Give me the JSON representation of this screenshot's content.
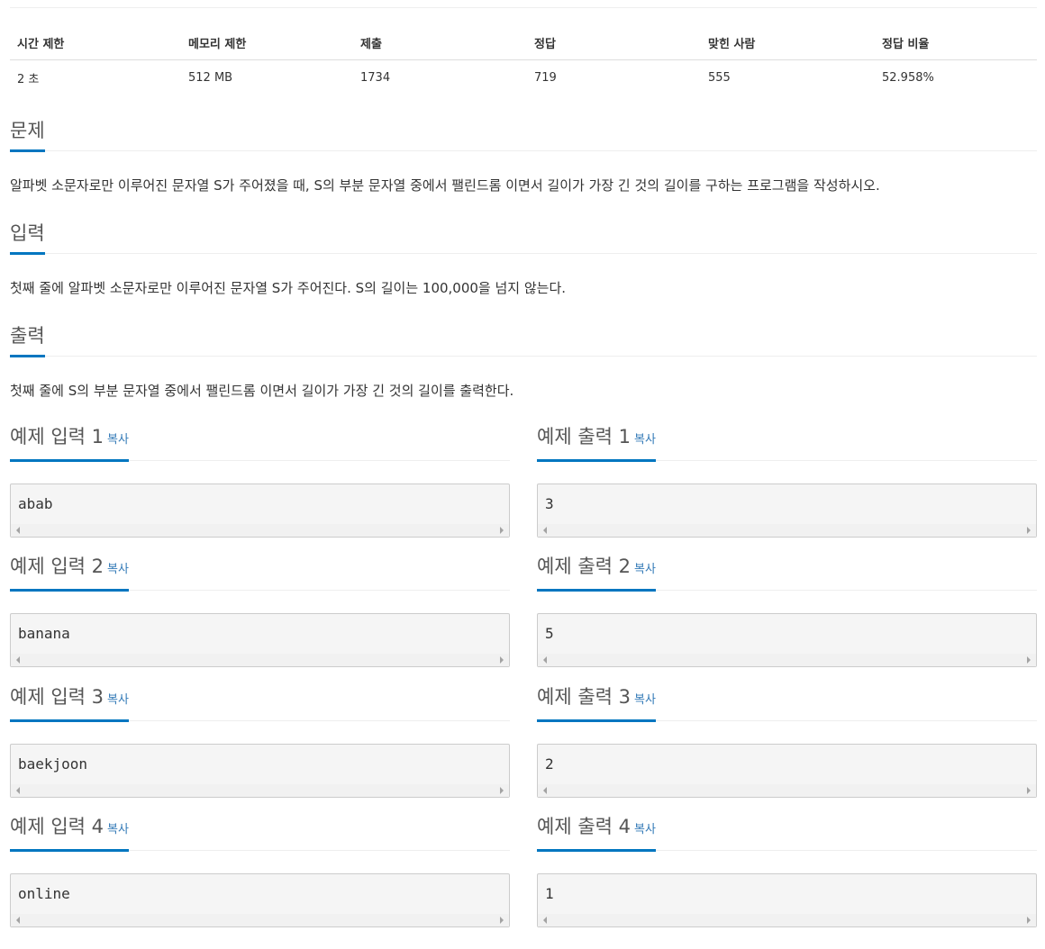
{
  "info": {
    "headers": [
      "시간 제한",
      "메모리 제한",
      "제출",
      "정답",
      "맞힌 사람",
      "정답 비율"
    ],
    "values": [
      "2 초",
      "512 MB",
      "1734",
      "719",
      "555",
      "52.958%"
    ]
  },
  "problem": {
    "title": "문제",
    "text": "알파벳 소문자로만 이루어진 문자열 S가 주어졌을 때, S의 부분 문자열 중에서 팰린드롬 이면서 길이가 가장 긴 것의 길이를 구하는 프로그램을 작성하시오."
  },
  "input": {
    "title": "입력",
    "text": "첫째 줄에 알파벳 소문자로만 이루어진 문자열 S가 주어진다. S의 길이는 100,000을 넘지 않는다."
  },
  "output": {
    "title": "출력",
    "text": "첫째 줄에 S의 부분 문자열 중에서 팰린드롬 이면서 길이가 가장 긴 것의 길이를 출력한다."
  },
  "copy_label": "복사",
  "examples": [
    {
      "in_title": "예제 입력 1",
      "in_value": "abab",
      "out_title": "예제 출력 1",
      "out_value": "3"
    },
    {
      "in_title": "예제 입력 2",
      "in_value": "banana",
      "out_title": "예제 출력 2",
      "out_value": "5"
    },
    {
      "in_title": "예제 입력 3",
      "in_value": "baekjoon",
      "out_title": "예제 출력 3",
      "out_value": "2"
    },
    {
      "in_title": "예제 입력 4",
      "in_value": "online",
      "out_title": "예제 출력 4",
      "out_value": "1"
    }
  ]
}
